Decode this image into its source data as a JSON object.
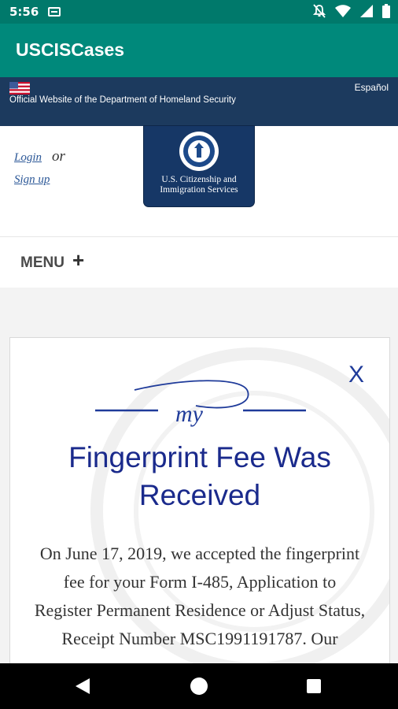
{
  "status_bar": {
    "time": "5:56",
    "icons": [
      "notification-icon",
      "mute-icon",
      "wifi-icon",
      "signal-icon",
      "battery-icon"
    ]
  },
  "app_bar": {
    "title": "USCISCases"
  },
  "gov_banner": {
    "official_text": "Official Website of the Department of Homeland Security",
    "language_link": "Español"
  },
  "header": {
    "login": "Login",
    "or": "or",
    "signup": "Sign up",
    "agency_line1": "U.S. Citizenship and",
    "agency_line2": "Immigration Services"
  },
  "menu": {
    "label": "MENU",
    "plus": "+"
  },
  "card": {
    "close": "X",
    "brand_script": "my",
    "title": "Fingerprint Fee Was Received",
    "message": "On June 17, 2019, we accepted the fingerprint fee for your Form I-485, Application to Register Permanent Residence or Adjust Status, Receipt Number MSC1991191787. Our"
  },
  "colors": {
    "status_bar": "#00796b",
    "app_bar": "#00897b",
    "gov_banner": "#1c3a5e",
    "logo_bg": "#163766",
    "heading": "#1a2a8c",
    "link": "#2b5797"
  }
}
